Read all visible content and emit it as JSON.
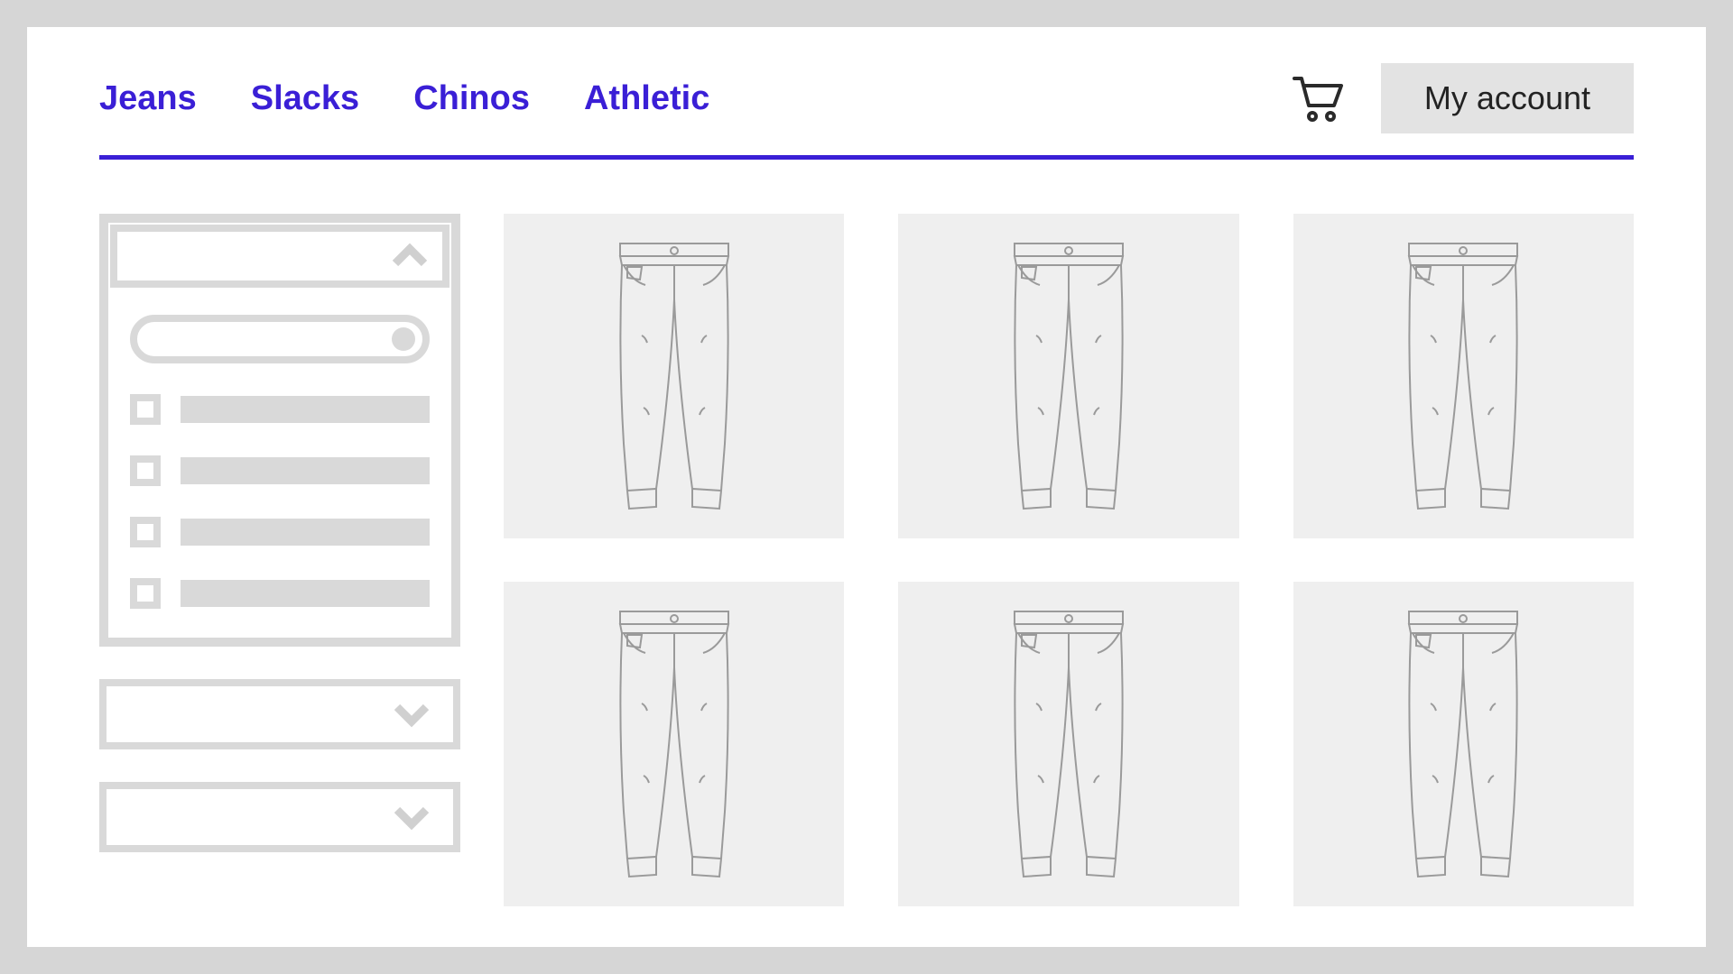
{
  "nav": {
    "items": [
      {
        "label": "Jeans"
      },
      {
        "label": "Slacks"
      },
      {
        "label": "Chinos"
      },
      {
        "label": "Athletic"
      }
    ]
  },
  "header": {
    "account_label": "My account"
  },
  "sidebar": {
    "filter_options": [
      {
        "label": ""
      },
      {
        "label": ""
      },
      {
        "label": ""
      },
      {
        "label": ""
      }
    ]
  },
  "products": [
    {},
    {},
    {},
    {},
    {},
    {}
  ],
  "colors": {
    "accent": "#3a1fd6",
    "muted": "#d9d9d9",
    "card_bg": "#efefef"
  }
}
